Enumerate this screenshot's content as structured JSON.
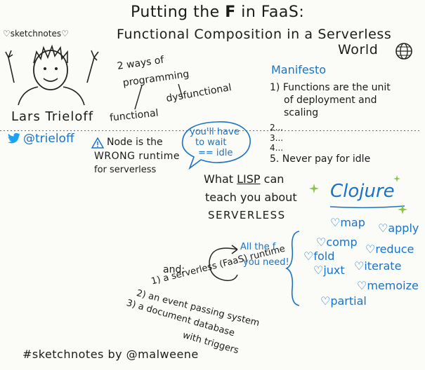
{
  "title": {
    "line1_prefix": "Putting the ",
    "line1_f": "F",
    "line1_suffix": " in FaaS:",
    "line2": "Functional Composition in a Serverless",
    "line3": "World"
  },
  "author": {
    "tag": "♡sketchnotes♡",
    "name": "Lars Trieloff",
    "handle": "@trieloff"
  },
  "ways": {
    "heading_line1": "2 ways of",
    "heading_line2": "programming",
    "functional": "functional",
    "dysfunctional": "dysfunctional"
  },
  "warning": {
    "line1": "Node is the",
    "line2": "WRONG runtime",
    "line3": "for serverless"
  },
  "bubble": {
    "line1": "you'll have",
    "line2": "to wait",
    "line3": "== idle"
  },
  "manifesto": {
    "title": "Manifesto",
    "item1_line1": "1) Functions are the unit",
    "item1_line2": "of deployment and",
    "item1_line3": "scaling",
    "item2": "2...",
    "item3": "3...",
    "item4": "4...",
    "item5": "5. Never pay for idle"
  },
  "lisp": {
    "line1_prefix": "What ",
    "line1_lisp": "LISP",
    "line1_suffix": " can",
    "line2": "teach you about",
    "line3": "SERVERLESS"
  },
  "clojure": {
    "title": "Clojure",
    "functions": [
      "♡map",
      "♡apply",
      "♡comp",
      "♡reduce",
      "♡fold",
      "♡iterate",
      "♡juxt",
      "♡memoize",
      "♡partial"
    ]
  },
  "callout": {
    "line1": "All the f",
    "line2": "you need!"
  },
  "requirements": {
    "and": "and:",
    "item1": "1) a serverless (FaaS) runtime",
    "item2": "2) an event passing system",
    "item3": "3) a document database",
    "item3b": "with triggers"
  },
  "footer": "#sketchnotes by @malweene",
  "colors": {
    "ink": "#1b1b1b",
    "accent": "#1a73c6",
    "sparkle": "#8bc34a"
  }
}
